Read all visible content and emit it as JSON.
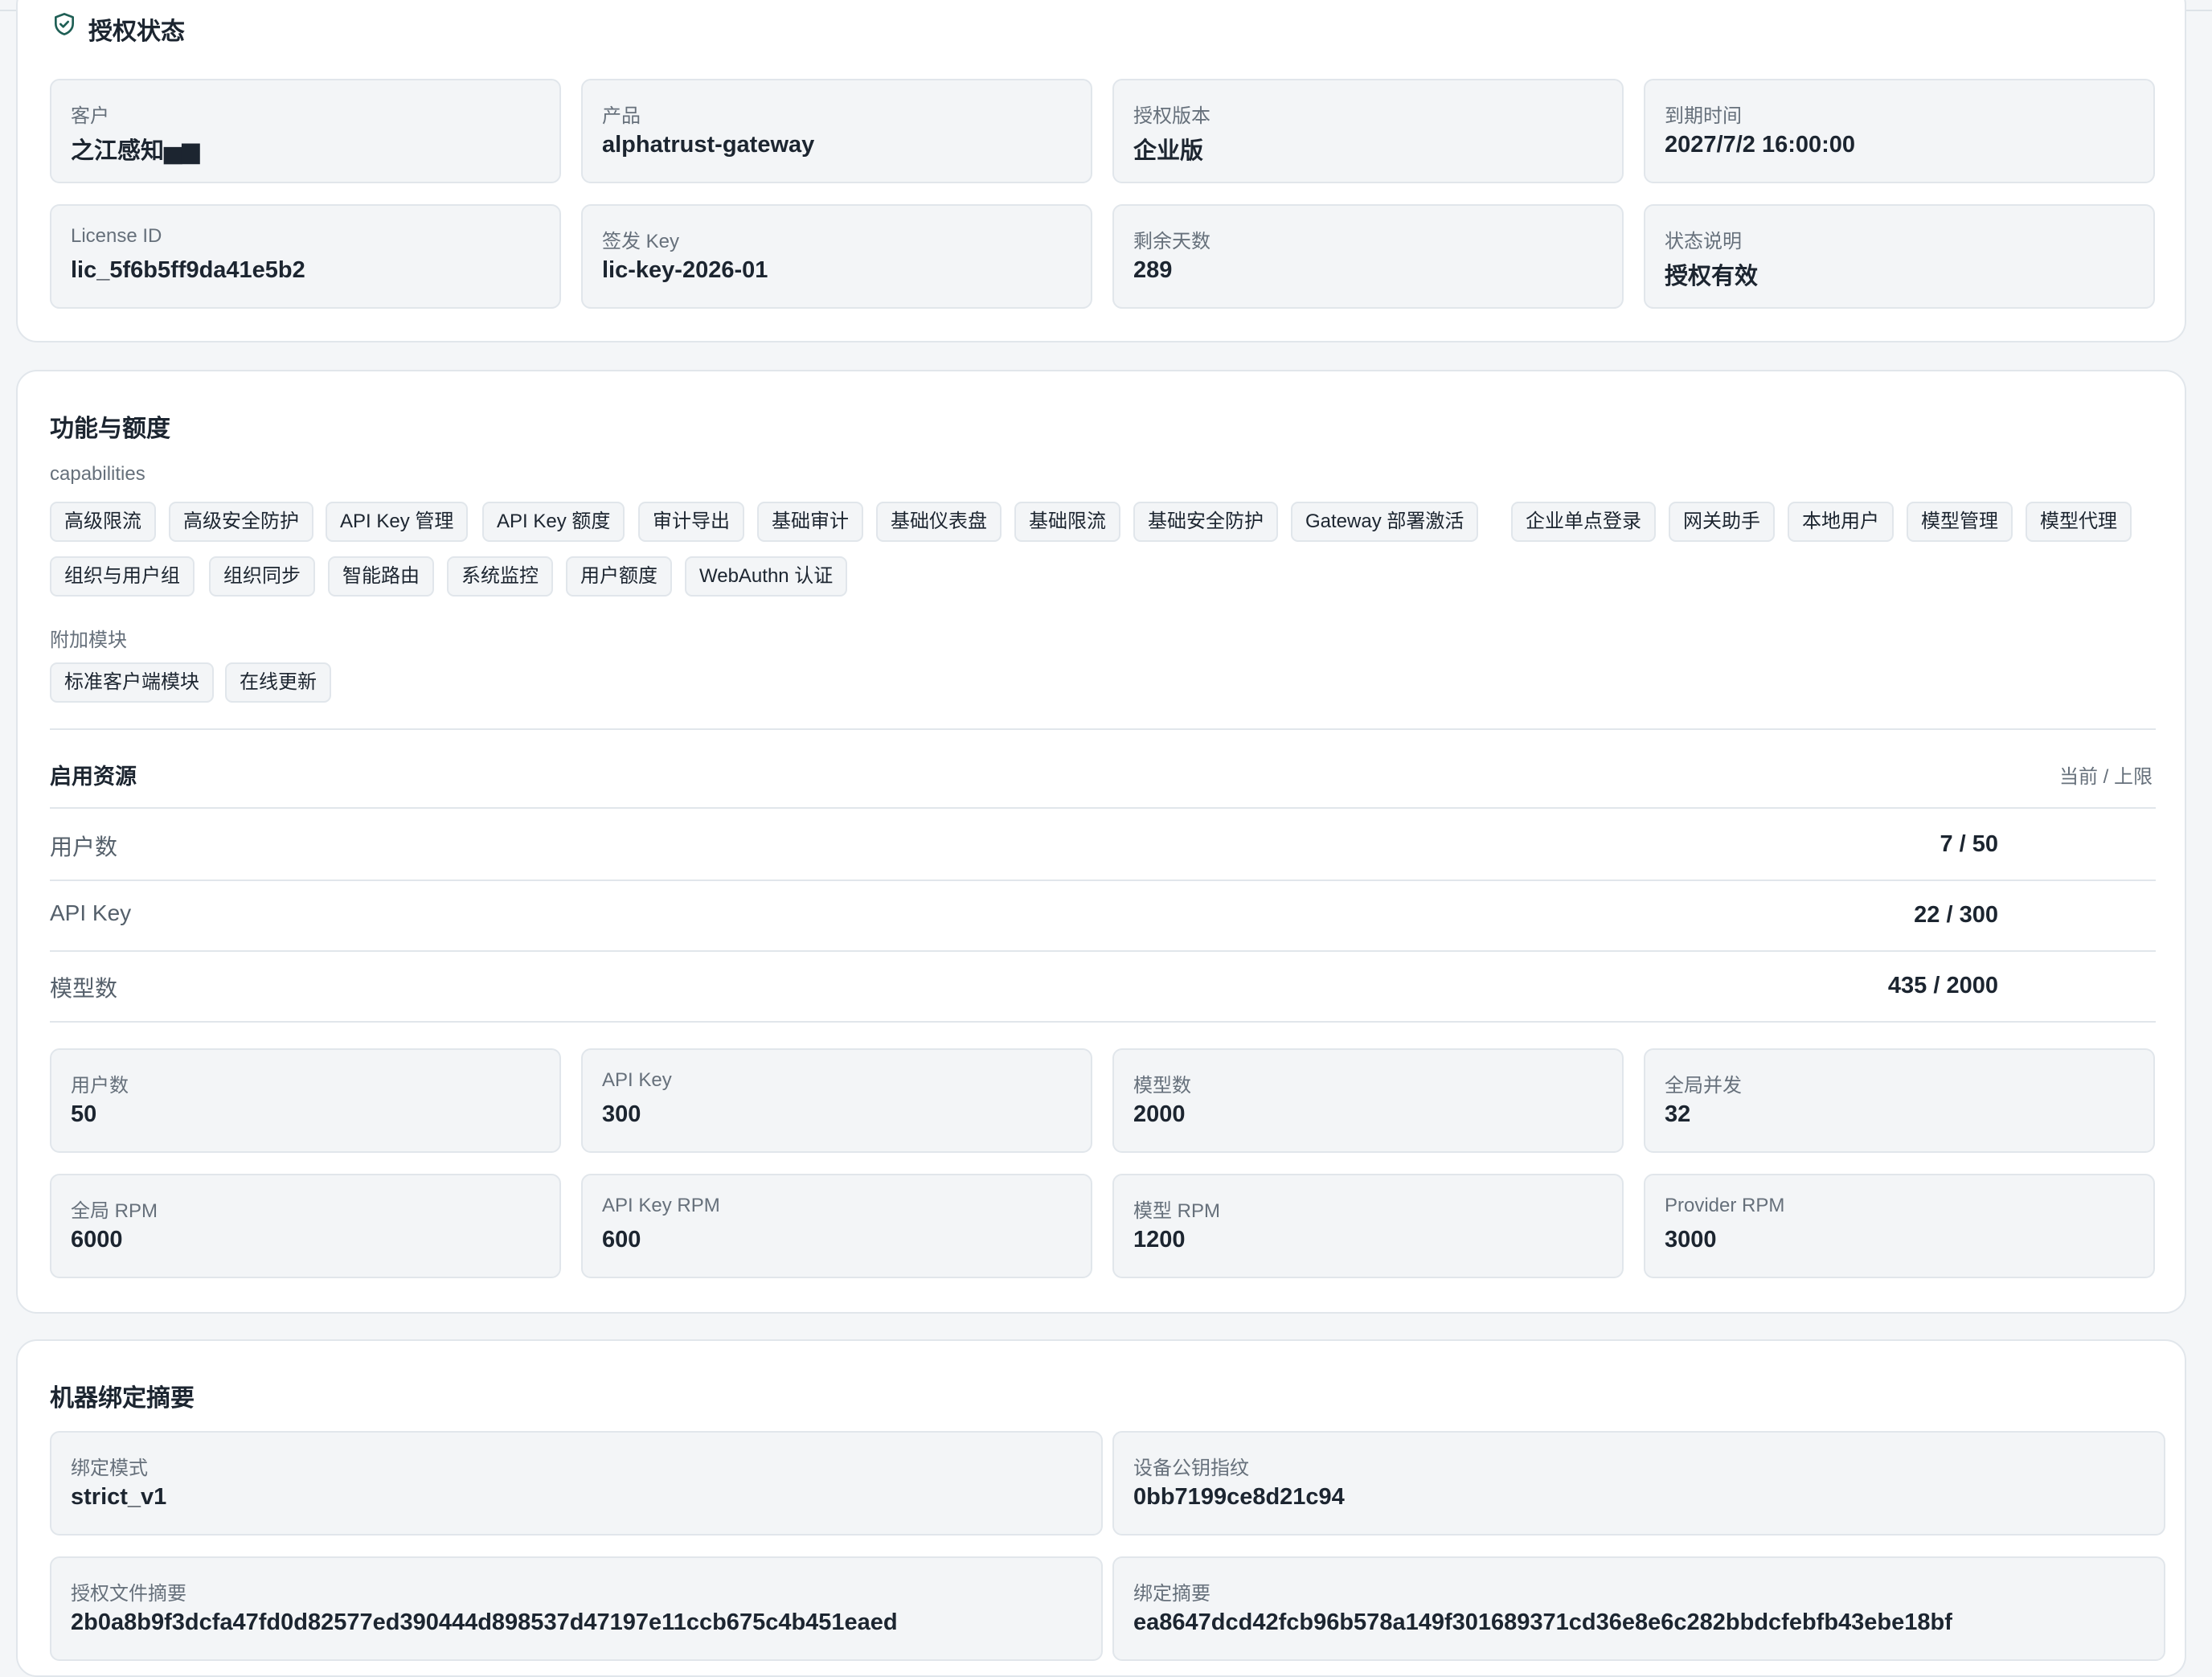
{
  "license_status": {
    "title": "授权状态",
    "fields": [
      {
        "label": "客户",
        "value": "之江感知▅▆"
      },
      {
        "label": "产品",
        "value": "alphatrust-gateway"
      },
      {
        "label": "授权版本",
        "value": "企业版"
      },
      {
        "label": "到期时间",
        "value": "2027/7/2 16:00:00"
      },
      {
        "label": "License ID",
        "value": "lic_5f6b5ff9da41e5b2"
      },
      {
        "label": "签发 Key",
        "value": "lic-key-2026-01"
      },
      {
        "label": "剩余天数",
        "value": "289"
      },
      {
        "label": "状态说明",
        "value": "授权有效"
      }
    ]
  },
  "features": {
    "title": "功能与额度",
    "capabilities_label": "capabilities",
    "capabilities": [
      "高级限流",
      "高级安全防护",
      "API Key 管理",
      "API Key 额度",
      "审计导出",
      "基础审计",
      "基础仪表盘",
      "基础限流",
      "基础安全防护",
      "Gateway 部署激活",
      "企业单点登录",
      "网关助手",
      "本地用户",
      "模型管理",
      "模型代理",
      "组织与用户组",
      "组织同步",
      "智能路由",
      "系统监控",
      "用户额度",
      "WebAuthn 认证"
    ],
    "addons_label": "附加模块",
    "addons": [
      "标准客户端模块",
      "在线更新"
    ],
    "resources": {
      "title": "启用资源",
      "header_right": "当前 / 上限",
      "rows": [
        {
          "label": "用户数",
          "value": "7 / 50"
        },
        {
          "label": "API Key",
          "value": "22 / 300"
        },
        {
          "label": "模型数",
          "value": "435 / 2000"
        }
      ]
    },
    "limits": [
      {
        "label": "用户数",
        "value": "50"
      },
      {
        "label": "API Key",
        "value": "300"
      },
      {
        "label": "模型数",
        "value": "2000"
      },
      {
        "label": "全局并发",
        "value": "32"
      },
      {
        "label": "全局 RPM",
        "value": "6000"
      },
      {
        "label": "API Key RPM",
        "value": "600"
      },
      {
        "label": "模型 RPM",
        "value": "1200"
      },
      {
        "label": "Provider RPM",
        "value": "3000"
      }
    ]
  },
  "binding": {
    "title": "机器绑定摘要",
    "fields": [
      {
        "label": "绑定模式",
        "value": "strict_v1"
      },
      {
        "label": "设备公钥指纹",
        "value": "0bb7199ce8d21c94"
      },
      {
        "label": "授权文件摘要",
        "value": "2b0a8b9f3dcfa47fd0d82577ed390444d898537d47197e11ccb675c4b451eaed"
      },
      {
        "label": "绑定摘要",
        "value": "ea8647dcd42fcb96b578a149f301689371cd36e8e6c282bbdcfebfb43ebe18bf"
      }
    ]
  },
  "colors": {
    "accent": "#1f5f55",
    "card_bg": "#ffffff",
    "field_bg": "#f3f5f7",
    "border": "#e1e6eb",
    "muted_text": "#66707b"
  }
}
